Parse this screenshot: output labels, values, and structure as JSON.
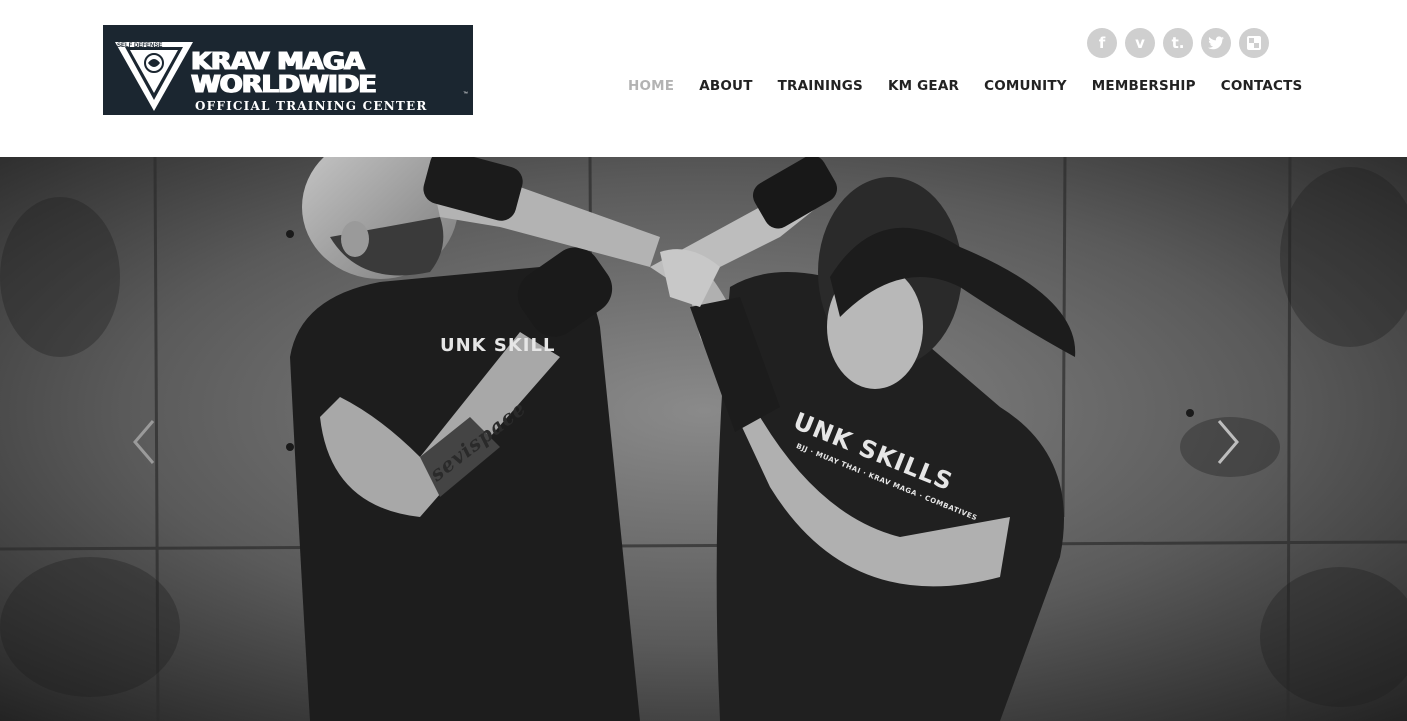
{
  "logo": {
    "title_line1": "KRAV MAGA",
    "title_line2": "WORLDWIDE",
    "subtitle": "OFFICIAL TRAINING CENTER",
    "emblem_text": [
      "SELF DEFENSE",
      "FIGHTING",
      "FITNESS"
    ],
    "trademark": "™"
  },
  "social": [
    {
      "name": "facebook",
      "glyph": "f"
    },
    {
      "name": "vimeo",
      "glyph": "v"
    },
    {
      "name": "tumblr",
      "glyph": "t."
    },
    {
      "name": "twitter",
      "glyph": "🐦"
    },
    {
      "name": "flickr",
      "glyph": "▣"
    }
  ],
  "nav": {
    "items": [
      {
        "label": "HOME",
        "active": true
      },
      {
        "label": "ABOUT",
        "active": false
      },
      {
        "label": "TRAININGS",
        "active": false
      },
      {
        "label": "KM GEAR",
        "active": false
      },
      {
        "label": "COMUNITY",
        "active": false
      },
      {
        "label": "MEMBERSHIP",
        "active": false
      },
      {
        "label": "CONTACTS",
        "active": false
      }
    ]
  },
  "hero": {
    "shirt_text_left": "UNK SKILL",
    "shirt_text_right": "UNK SKILLS",
    "shirt_subtext_right": "BJJ · MUAY THAI · KRAV MAGA · COMBATIVES",
    "tattoo_text": "sevispace"
  },
  "colors": {
    "logo_bg": "#1b2630",
    "nav_text": "#222222",
    "nav_active": "#b3b3b3",
    "social_bg": "#cfcfcf"
  }
}
